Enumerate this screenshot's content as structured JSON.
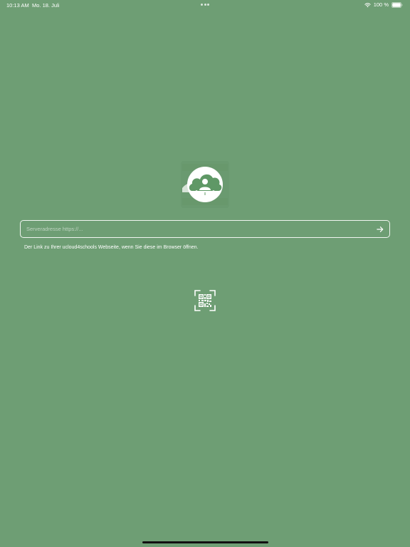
{
  "status_bar": {
    "time": "10:13 AM",
    "date": "Mo. 18. Juli",
    "battery_percent": "100 %",
    "battery_level": 1.0,
    "icons": [
      "wifi-icon",
      "battery-icon"
    ]
  },
  "logo": {
    "icon": "ucloud4schools-logo-icon"
  },
  "server": {
    "placeholder": "Serveradresse https://...",
    "value": "",
    "submit_icon": "arrow-right-icon"
  },
  "helper_text": "Der Link zu Ihrer ucloud4schools Webseite, wenn Sie diese im Browser öffnen.",
  "qr": {
    "icon": "qr-code-scan-icon"
  },
  "colors": {
    "background": "#6e9e74",
    "foreground": "#ffffff"
  }
}
